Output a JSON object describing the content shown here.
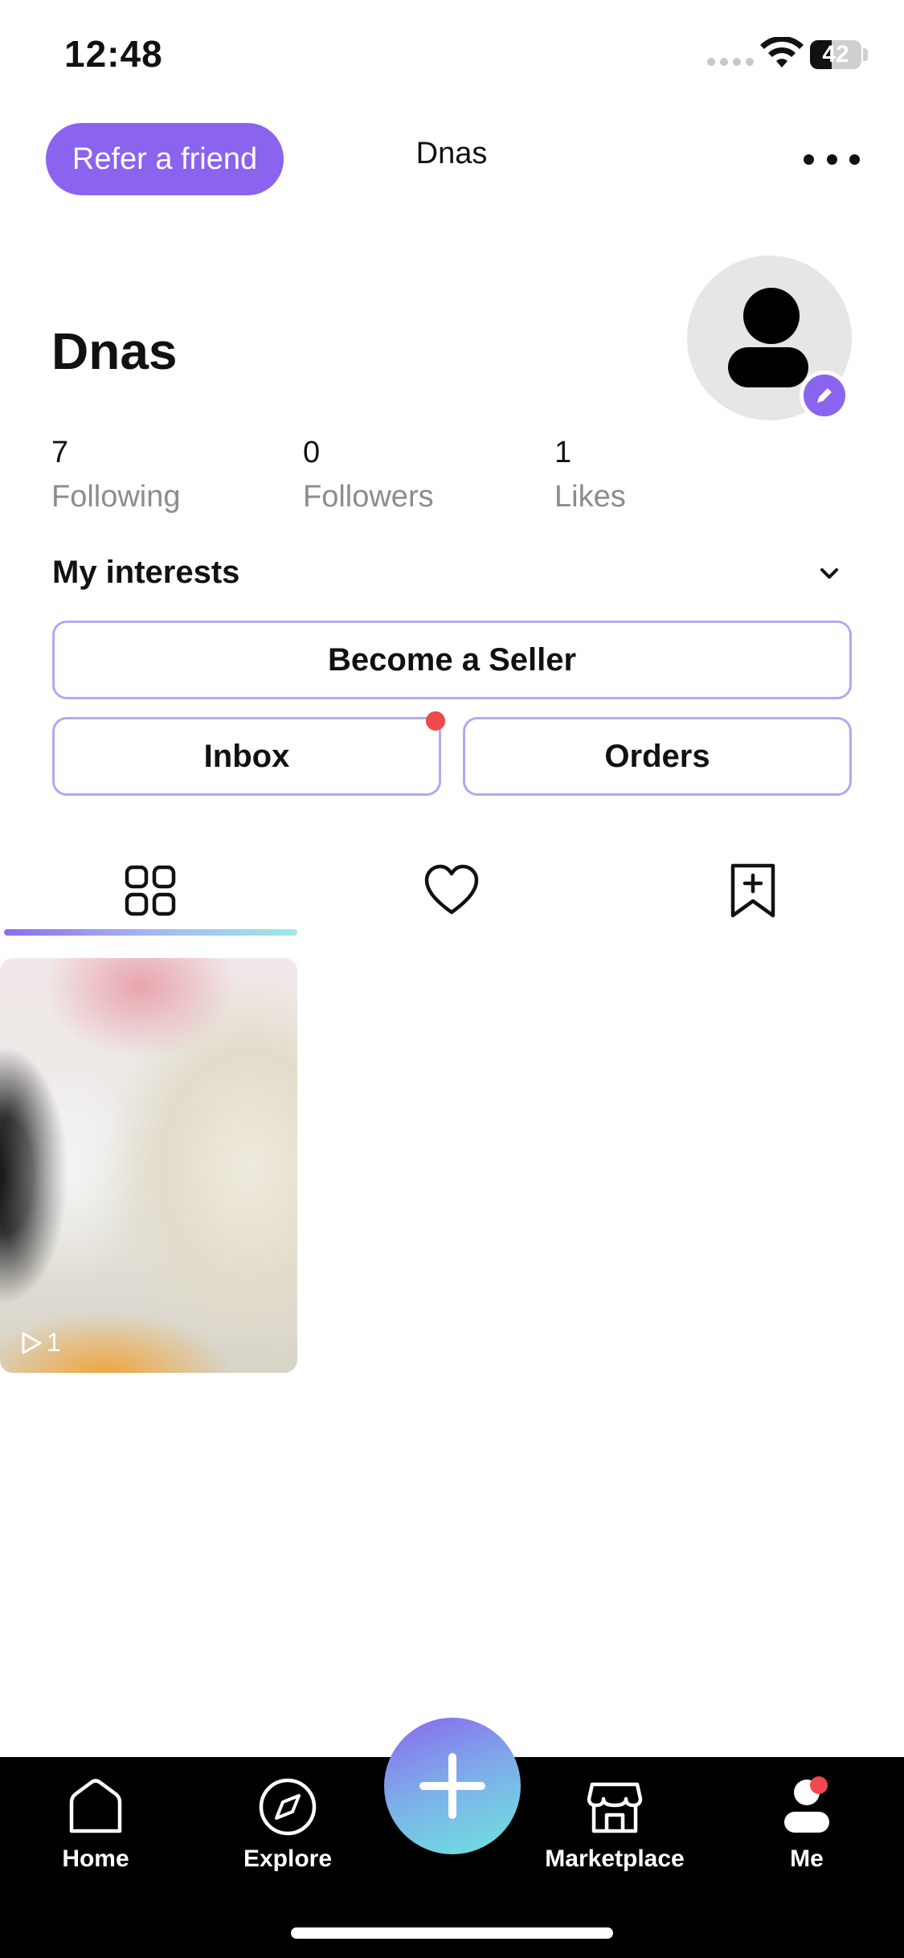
{
  "status_bar": {
    "time": "12:48",
    "battery": "42",
    "battery_level": 0.42
  },
  "header": {
    "refer_label": "Refer a friend",
    "title": "Dnas"
  },
  "profile": {
    "name": "Dnas",
    "stats": [
      {
        "count": "7",
        "label": "Following"
      },
      {
        "count": "0",
        "label": "Followers"
      },
      {
        "count": "1",
        "label": "Likes"
      }
    ],
    "interests_label": "My interests"
  },
  "actions": {
    "seller": "Become a Seller",
    "inbox": "Inbox",
    "orders": "Orders"
  },
  "tabs": [
    "grid-icon",
    "heart-icon",
    "bookmark-plus-icon"
  ],
  "posts": [
    {
      "play_count": "1"
    }
  ],
  "nav": {
    "home": "Home",
    "explore": "Explore",
    "marketplace": "Marketplace",
    "me": "Me"
  },
  "colors": {
    "accent": "#8a63ee",
    "badge": "#f0484d",
    "nav_bg": "#000000"
  }
}
